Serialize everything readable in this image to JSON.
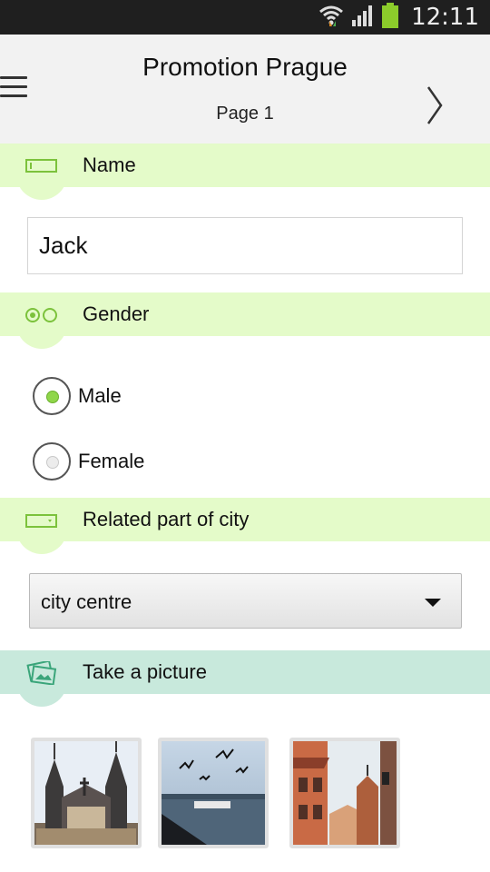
{
  "status_bar": {
    "time": "12:11",
    "icons": [
      "wifi-icon",
      "signal-icon",
      "battery-icon"
    ]
  },
  "header": {
    "title": "Promotion Prague",
    "subtitle": "Page 1",
    "menu_icon": "hamburger-menu-icon",
    "next_icon": "chevron-right-icon"
  },
  "sections": {
    "name": {
      "label": "Name",
      "icon": "text-field-icon",
      "value": "Jack"
    },
    "gender": {
      "label": "Gender",
      "icon": "radio-options-icon",
      "options": [
        "Male",
        "Female"
      ],
      "selected": "Male"
    },
    "city_part": {
      "label": "Related part of city",
      "icon": "dropdown-icon",
      "selected": "city centre"
    },
    "picture": {
      "label": "Take a picture",
      "icon": "photos-icon",
      "thumbnails": [
        "church-towers-photo",
        "river-birds-photo",
        "street-buildings-photo"
      ]
    }
  },
  "colors": {
    "section_green": "#e4fbc9",
    "section_teal": "#c8e9dc",
    "accent": "#8fd64a",
    "statusbar": "#1f1f1f",
    "appbar": "#f2f2f2"
  }
}
